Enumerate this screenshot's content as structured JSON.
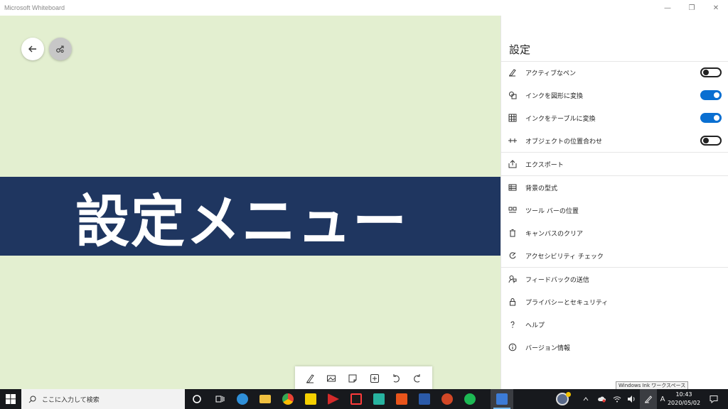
{
  "window": {
    "title": "Microsoft Whiteboard",
    "minimize_glyph": "—",
    "restore_glyph": "❐",
    "close_glyph": "✕"
  },
  "canvas": {
    "background": "#e3efd0",
    "banner_text": "設定メニュー",
    "banner_color": "#1f3660",
    "back_icon": "back-arrow-icon",
    "share_icon": "share-icon",
    "toolbar_tools": [
      "pen-icon",
      "image-icon",
      "sticky-note-icon",
      "insert-icon",
      "undo-icon",
      "redo-icon"
    ]
  },
  "settings": {
    "title": "設定",
    "accent": "#0a6fd1",
    "toggles": [
      {
        "label": "アクティブなペン",
        "icon": "pen-icon",
        "on": false
      },
      {
        "label": "インクを図形に変換",
        "icon": "shapes-icon",
        "on": true
      },
      {
        "label": "インクをテーブルに変換",
        "icon": "table-icon",
        "on": true
      },
      {
        "label": "オブジェクトの位置合わせ",
        "icon": "snap-icon",
        "on": false
      }
    ],
    "export": {
      "label": "エクスポート",
      "icon": "export-icon"
    },
    "board_items": [
      {
        "label": "背景の型式",
        "icon": "background-icon"
      },
      {
        "label": "ツール バーの位置",
        "icon": "toolbar-position-icon"
      },
      {
        "label": "キャンバスのクリア",
        "icon": "trash-icon"
      },
      {
        "label": "アクセシビリティ チェック",
        "icon": "accessibility-icon"
      }
    ],
    "info_items": [
      {
        "label": "フィードバックの送信",
        "icon": "feedback-icon"
      },
      {
        "label": "プライバシーとセキュリティ",
        "icon": "lock-icon"
      },
      {
        "label": "ヘルプ",
        "icon": "help-icon"
      },
      {
        "label": "バージョン情報",
        "icon": "info-icon"
      }
    ]
  },
  "tooltip": "Windows Ink ワークスペース",
  "taskbar": {
    "search_placeholder": "ここに入力して検索",
    "apps": [
      {
        "name": "cortana",
        "color": "#ffffff"
      },
      {
        "name": "task-view",
        "color": "#ffffff"
      },
      {
        "name": "edge",
        "color": "#2f8fd8"
      },
      {
        "name": "file-explorer",
        "color": "#f0c040"
      },
      {
        "name": "chrome",
        "color": "#34a853"
      },
      {
        "name": "sticky-notes",
        "color": "#f5d000"
      },
      {
        "name": "media-player",
        "color": "#d42a2a"
      },
      {
        "name": "screen-record",
        "color": "#ff3b3b"
      },
      {
        "name": "robot-app",
        "color": "#27b3a0"
      },
      {
        "name": "office",
        "color": "#e8541b"
      },
      {
        "name": "word",
        "color": "#2b5aa8"
      },
      {
        "name": "powerpoint",
        "color": "#d24726"
      },
      {
        "name": "spotify",
        "color": "#1db954"
      },
      {
        "name": "whiteboard",
        "color": "#3c7bd6"
      }
    ],
    "ime": "A",
    "time": "10:43",
    "date": "2020/05/02"
  }
}
